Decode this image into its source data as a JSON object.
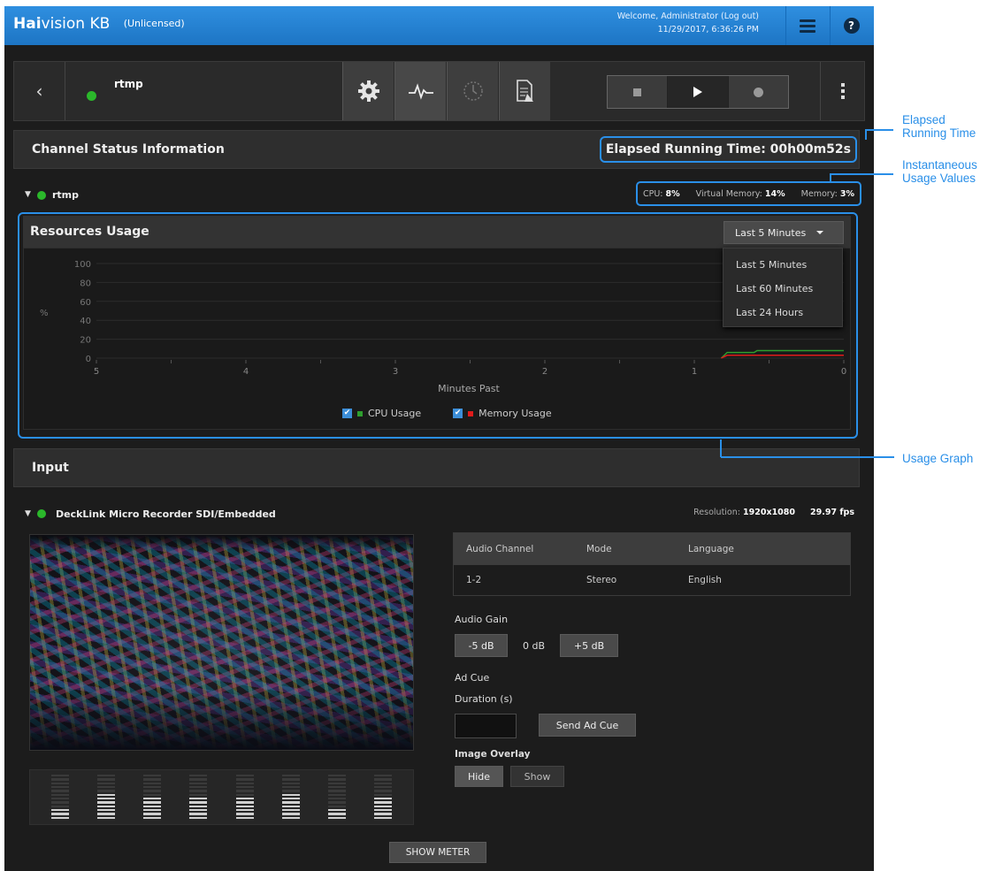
{
  "topbar": {
    "brand_hai": "Hai",
    "brand_rest": "vision KB",
    "license": "(Unlicensed)",
    "welcome": "Welcome, Administrator   (Log out)",
    "datetime": "11/29/2017, 6:36:26 PM"
  },
  "channel": {
    "name": "rtmp",
    "status_color": "#2bb82b"
  },
  "status_section": {
    "title": "Channel Status Information",
    "elapsed": "Elapsed Running Time: 00h00m52s"
  },
  "process": {
    "name": "rtmp",
    "cpu_label": "CPU:",
    "cpu": "8%",
    "vmem_label": "Virtual Memory:",
    "vmem": "14%",
    "mem_label": "Memory:",
    "mem": "3%"
  },
  "resources": {
    "title": "Resources Usage",
    "range_selected": "Last 5 Minutes",
    "range_options": [
      "Last 5 Minutes",
      "Last 60 Minutes",
      "Last 24 Hours"
    ],
    "y_ticks": [
      "100",
      "80",
      "60",
      "40",
      "20",
      "0"
    ],
    "y_label": "%",
    "x_ticks": [
      "5",
      "4",
      "3",
      "2",
      "1",
      "0"
    ],
    "x_label": "Minutes Past",
    "legend_cpu": "CPU Usage",
    "legend_mem": "Memory Usage",
    "cpu_color": "#2e9e2e",
    "mem_color": "#e01b1b"
  },
  "chart_data": {
    "type": "line",
    "ylabel": "%",
    "xlabel": "Minutes Past",
    "xlim": [
      5,
      0
    ],
    "ylim": [
      0,
      100
    ],
    "series": [
      {
        "name": "CPU Usage",
        "points": [
          [
            0.82,
            0
          ],
          [
            0.78,
            6
          ],
          [
            0.6,
            6
          ],
          [
            0.58,
            8
          ],
          [
            0,
            8
          ]
        ]
      },
      {
        "name": "Memory Usage",
        "points": [
          [
            0.82,
            0
          ],
          [
            0.78,
            3
          ],
          [
            0,
            3
          ]
        ]
      }
    ]
  },
  "input_section": {
    "title": "Input",
    "device": "DeckLink Micro Recorder SDI/Embedded",
    "resolution_label": "Resolution:",
    "resolution": "1920x1080",
    "fps": "29.97 fps"
  },
  "audio_table": {
    "headers": [
      "Audio Channel",
      "Mode",
      "Language"
    ],
    "rows": [
      [
        "1-2",
        "Stereo",
        "English"
      ]
    ]
  },
  "controls": {
    "audio_gain_label": "Audio Gain",
    "gain_minus": "-5 dB",
    "gain_value": "0 dB",
    "gain_plus": "+5 dB",
    "ad_cue_label": "Ad Cue",
    "duration_label": "Duration (s)",
    "send_ad_cue": "Send Ad Cue",
    "image_overlay_label": "Image Overlay",
    "hide": "Hide",
    "show": "Show",
    "show_meter": "SHOW METER"
  },
  "meters": [
    {
      "level": 0.25
    },
    {
      "level": 0.55
    },
    {
      "level": 0.5
    },
    {
      "level": 0.5
    },
    {
      "level": 0.5
    },
    {
      "level": 0.55
    },
    {
      "level": 0.25
    },
    {
      "level": 0.5
    }
  ],
  "annotations": {
    "elapsed": "Elapsed\nRunning Time",
    "usage": "Instantaneous\nUsage Values",
    "graph": "Usage Graph"
  },
  "accent_color": "#2a8fe8"
}
